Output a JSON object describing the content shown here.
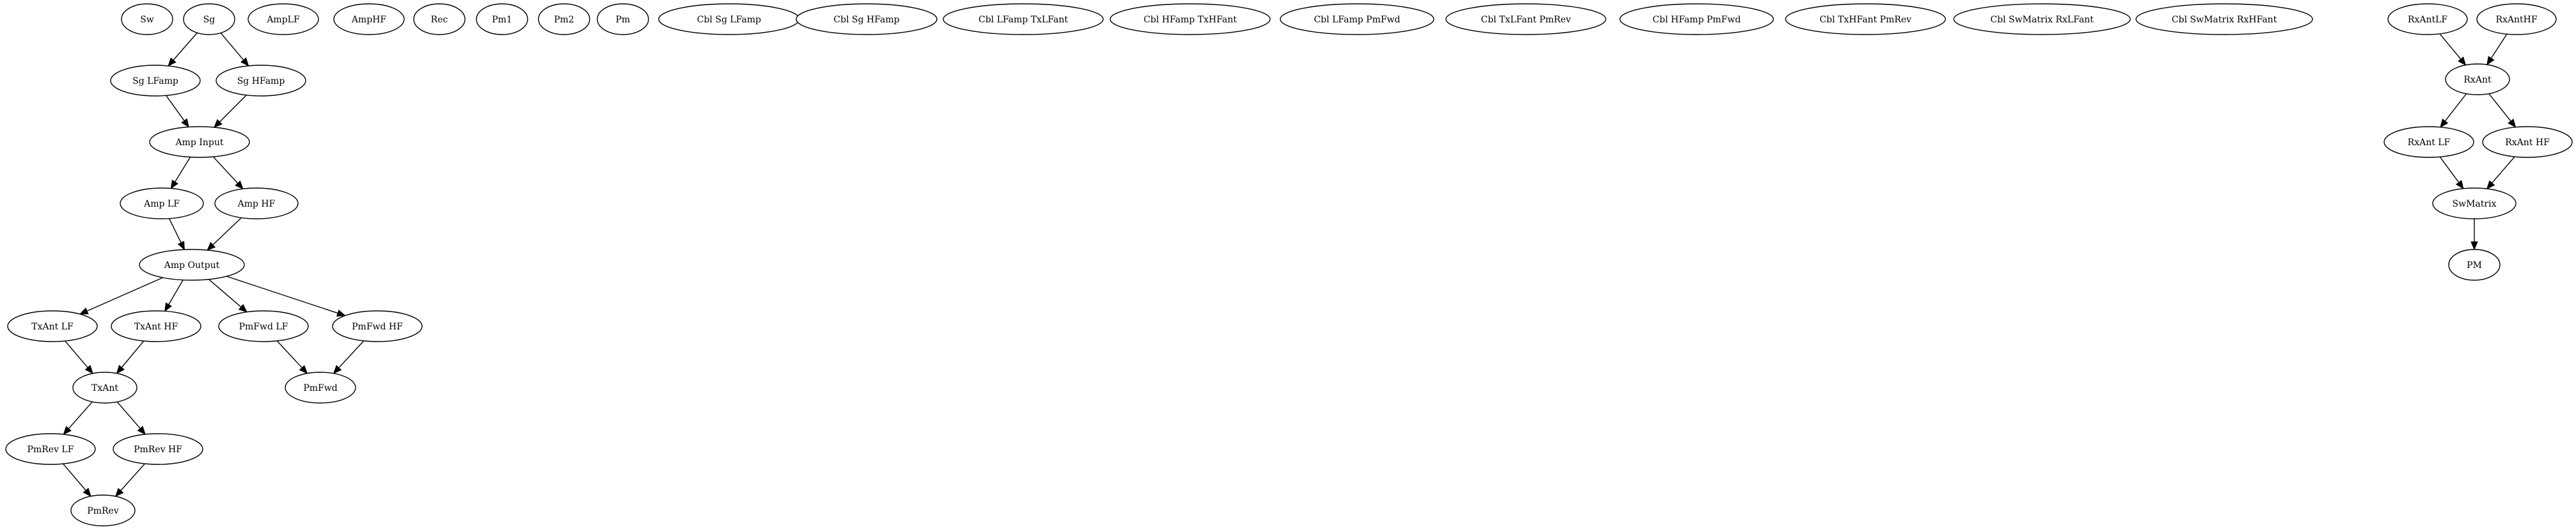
{
  "nodes": [
    {
      "id": "sw",
      "label": "Sw"
    },
    {
      "id": "sg",
      "label": "Sg"
    },
    {
      "id": "amplf",
      "label": "AmpLF"
    },
    {
      "id": "amphf",
      "label": "AmpHF"
    },
    {
      "id": "rec",
      "label": "Rec"
    },
    {
      "id": "pm1",
      "label": "Pm1"
    },
    {
      "id": "pm2",
      "label": "Pm2"
    },
    {
      "id": "pm",
      "label": "Pm"
    },
    {
      "id": "cbl-sg-lfamp",
      "label": "Cbl Sg LFamp"
    },
    {
      "id": "cbl-sg-hfamp",
      "label": "Cbl Sg HFamp"
    },
    {
      "id": "cbl-lfamp-txlfant",
      "label": "Cbl LFamp TxLFant"
    },
    {
      "id": "cbl-hfamp-txhfant",
      "label": "Cbl HFamp TxHFant"
    },
    {
      "id": "cbl-lfamp-pmfwd",
      "label": "Cbl LFamp PmFwd"
    },
    {
      "id": "cbl-txlfant-pmrev",
      "label": "Cbl TxLFant PmRev"
    },
    {
      "id": "cbl-hfamp-pmfwd",
      "label": "Cbl HFamp PmFwd"
    },
    {
      "id": "cbl-txhfant-pmrev",
      "label": "Cbl TxHFant PmRev"
    },
    {
      "id": "cbl-swmatrix-rxlfant",
      "label": "Cbl SwMatrix RxLFant"
    },
    {
      "id": "cbl-swmatrix-rxhfant",
      "label": "Cbl SwMatrix RxHFant"
    },
    {
      "id": "rxantlf",
      "label": "RxAntLF"
    },
    {
      "id": "rxanthf",
      "label": "RxAntHF"
    },
    {
      "id": "sg-lfamp",
      "label": "Sg LFamp"
    },
    {
      "id": "sg-hfamp",
      "label": "Sg HFamp"
    },
    {
      "id": "rxant",
      "label": "RxAnt"
    },
    {
      "id": "amp-input",
      "label": "Amp Input"
    },
    {
      "id": "rxant-lf",
      "label": "RxAnt LF"
    },
    {
      "id": "rxant-hf",
      "label": "RxAnt HF"
    },
    {
      "id": "amp-lf",
      "label": "Amp LF"
    },
    {
      "id": "amp-hf",
      "label": "Amp HF"
    },
    {
      "id": "swmatrix",
      "label": "SwMatrix"
    },
    {
      "id": "amp-output",
      "label": "Amp Output"
    },
    {
      "id": "pm-node",
      "label": "PM"
    },
    {
      "id": "txant-lf",
      "label": "TxAnt LF"
    },
    {
      "id": "txant-hf",
      "label": "TxAnt HF"
    },
    {
      "id": "pmfwd-lf",
      "label": "PmFwd LF"
    },
    {
      "id": "pmfwd-hf",
      "label": "PmFwd HF"
    },
    {
      "id": "txant",
      "label": "TxAnt"
    },
    {
      "id": "pmfwd",
      "label": "PmFwd"
    },
    {
      "id": "pmrev-lf",
      "label": "PmRev LF"
    },
    {
      "id": "pmrev-hf",
      "label": "PmRev HF"
    },
    {
      "id": "pmrev",
      "label": "PmRev"
    }
  ],
  "edges": [
    [
      "sg",
      "sg-lfamp"
    ],
    [
      "sg",
      "sg-hfamp"
    ],
    [
      "sg-lfamp",
      "amp-input"
    ],
    [
      "sg-hfamp",
      "amp-input"
    ],
    [
      "amp-input",
      "amp-lf"
    ],
    [
      "amp-input",
      "amp-hf"
    ],
    [
      "amp-lf",
      "amp-output"
    ],
    [
      "amp-hf",
      "amp-output"
    ],
    [
      "amp-output",
      "txant-lf"
    ],
    [
      "amp-output",
      "txant-hf"
    ],
    [
      "amp-output",
      "pmfwd-lf"
    ],
    [
      "amp-output",
      "pmfwd-hf"
    ],
    [
      "txant-lf",
      "txant"
    ],
    [
      "txant-hf",
      "txant"
    ],
    [
      "pmfwd-lf",
      "pmfwd"
    ],
    [
      "pmfwd-hf",
      "pmfwd"
    ],
    [
      "txant",
      "pmrev-lf"
    ],
    [
      "txant",
      "pmrev-hf"
    ],
    [
      "pmrev-lf",
      "pmrev"
    ],
    [
      "pmrev-hf",
      "pmrev"
    ],
    [
      "rxantlf",
      "rxant"
    ],
    [
      "rxanthf",
      "rxant"
    ],
    [
      "rxant",
      "rxant-lf"
    ],
    [
      "rxant",
      "rxant-hf"
    ],
    [
      "rxant-lf",
      "swmatrix"
    ],
    [
      "rxant-hf",
      "swmatrix"
    ],
    [
      "swmatrix",
      "pm-node"
    ]
  ]
}
